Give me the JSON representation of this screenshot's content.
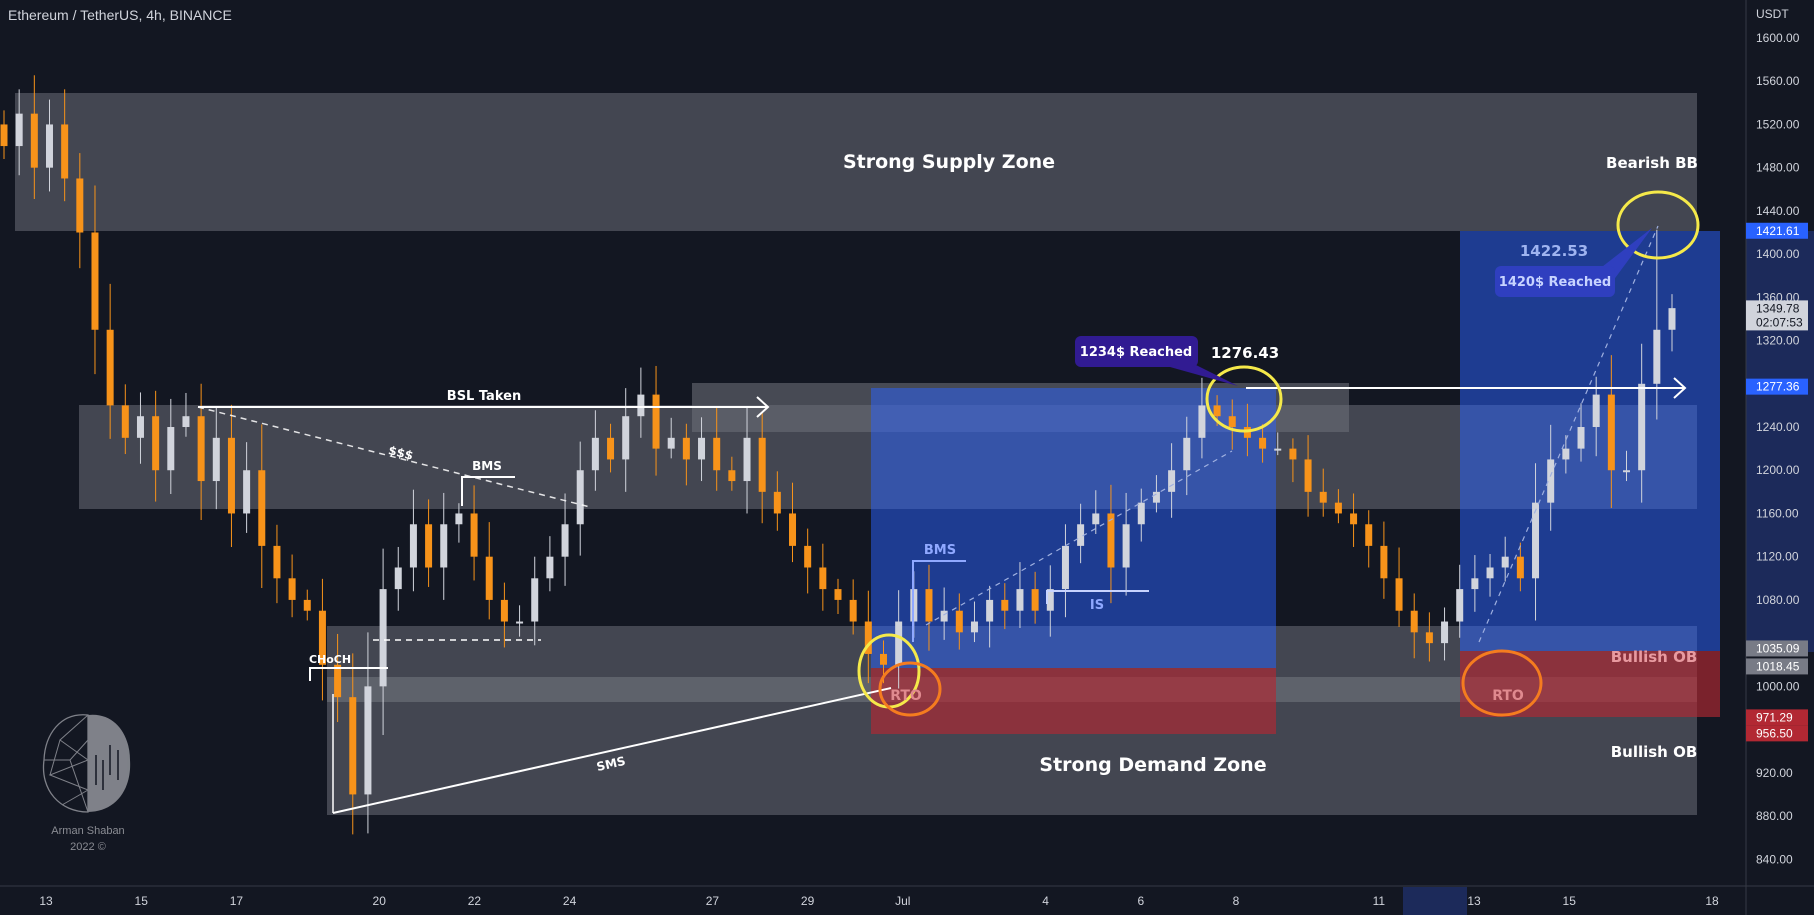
{
  "header": {
    "title": "Ethereum / TetherUS, 4h, BINANCE"
  },
  "colors": {
    "background": "#131722",
    "bull": "#d1d4dc",
    "bear": "#f7931a",
    "zone": "#434651",
    "blue_box": "#2962ff",
    "red_box": "#b22833",
    "callout_purple": "#311b92",
    "callout_blue": "#2f3fbf",
    "circle_yellow": "#f5e94a",
    "circle_orange": "#f57c1f"
  },
  "chart_data": {
    "type": "candlestick",
    "symbol": "Ethereum / TetherUS",
    "interval": "4h",
    "exchange": "BINANCE",
    "price_unit": "USDT",
    "ylim": [
      820,
      1620
    ],
    "y_ticks": [
      "1600.00",
      "1560.00",
      "1520.00",
      "1480.00",
      "1440.00",
      "1400.00",
      "1360.00",
      "1320.00",
      "1240.00",
      "1200.00",
      "1160.00",
      "1120.00",
      "1080.00",
      "1000.00",
      "920.00",
      "880.00",
      "840.00"
    ],
    "x_ticks": [
      "13",
      "15",
      "17",
      "20",
      "22",
      "24",
      "27",
      "29",
      "Jul",
      "4",
      "6",
      "8",
      "11",
      "13",
      "15",
      "18"
    ],
    "highlighted_x_range": [
      "12",
      "13"
    ],
    "close": [
      1500,
      1530,
      1480,
      1520,
      1470,
      1420,
      1330,
      1260,
      1230,
      1250,
      1200,
      1240,
      1250,
      1190,
      1230,
      1160,
      1200,
      1130,
      1100,
      1080,
      1070,
      1020,
      990,
      900,
      1000,
      1090,
      1110,
      1150,
      1110,
      1150,
      1160,
      1120,
      1080,
      1060,
      1060,
      1100,
      1120,
      1150,
      1200,
      1230,
      1210,
      1250,
      1270,
      1220,
      1230,
      1210,
      1230,
      1200,
      1190,
      1230,
      1180,
      1160,
      1130,
      1110,
      1090,
      1080,
      1060,
      1030,
      1020,
      1060,
      1090,
      1060,
      1070,
      1050,
      1060,
      1080,
      1070,
      1090,
      1070,
      1090,
      1130,
      1150,
      1160,
      1110,
      1150,
      1170,
      1180,
      1200,
      1230,
      1260,
      1250,
      1240,
      1230,
      1220,
      1220,
      1210,
      1180,
      1170,
      1160,
      1150,
      1130,
      1100,
      1070,
      1050,
      1040,
      1060,
      1090,
      1100,
      1110,
      1120,
      1100,
      1170,
      1210,
      1220,
      1240,
      1270,
      1200,
      1200,
      1280,
      1330,
      1350
    ],
    "peak_high": 1422.53,
    "price_markers": [
      {
        "value": "1421.61",
        "style": "blue"
      },
      {
        "value": "1349.78",
        "sub": "02:07:53",
        "style": "light"
      },
      {
        "value": "1277.36",
        "style": "blue"
      },
      {
        "value": "1035.09",
        "style": "gray"
      },
      {
        "value": "1018.45",
        "style": "gray"
      },
      {
        "value": "971.29",
        "style": "red"
      },
      {
        "value": "956.50",
        "style": "red"
      }
    ]
  },
  "annotations": {
    "supply_zone": "Strong Supply Zone",
    "bearish_bb": "Bearish BB",
    "demand_zone": "Strong Demand Zone",
    "bullish_ob_1": "Bullish OB",
    "bullish_ob_2": "Bullish OB",
    "bsl_taken": "BSL Taken",
    "liquidity": "$$$",
    "bms_1": "BMS",
    "bms_2": "BMS",
    "choch": "CHoCH",
    "sms": "SMS",
    "is": "IS",
    "rto_1": "RTO",
    "rto_2": "RTO",
    "high_1": "1276.43",
    "callout_1": "1234$ Reached",
    "high_2": "1422.53",
    "callout_2": "1420$ Reached"
  },
  "watermark": {
    "name": "Arman Shaban",
    "year": "2022 ©"
  }
}
